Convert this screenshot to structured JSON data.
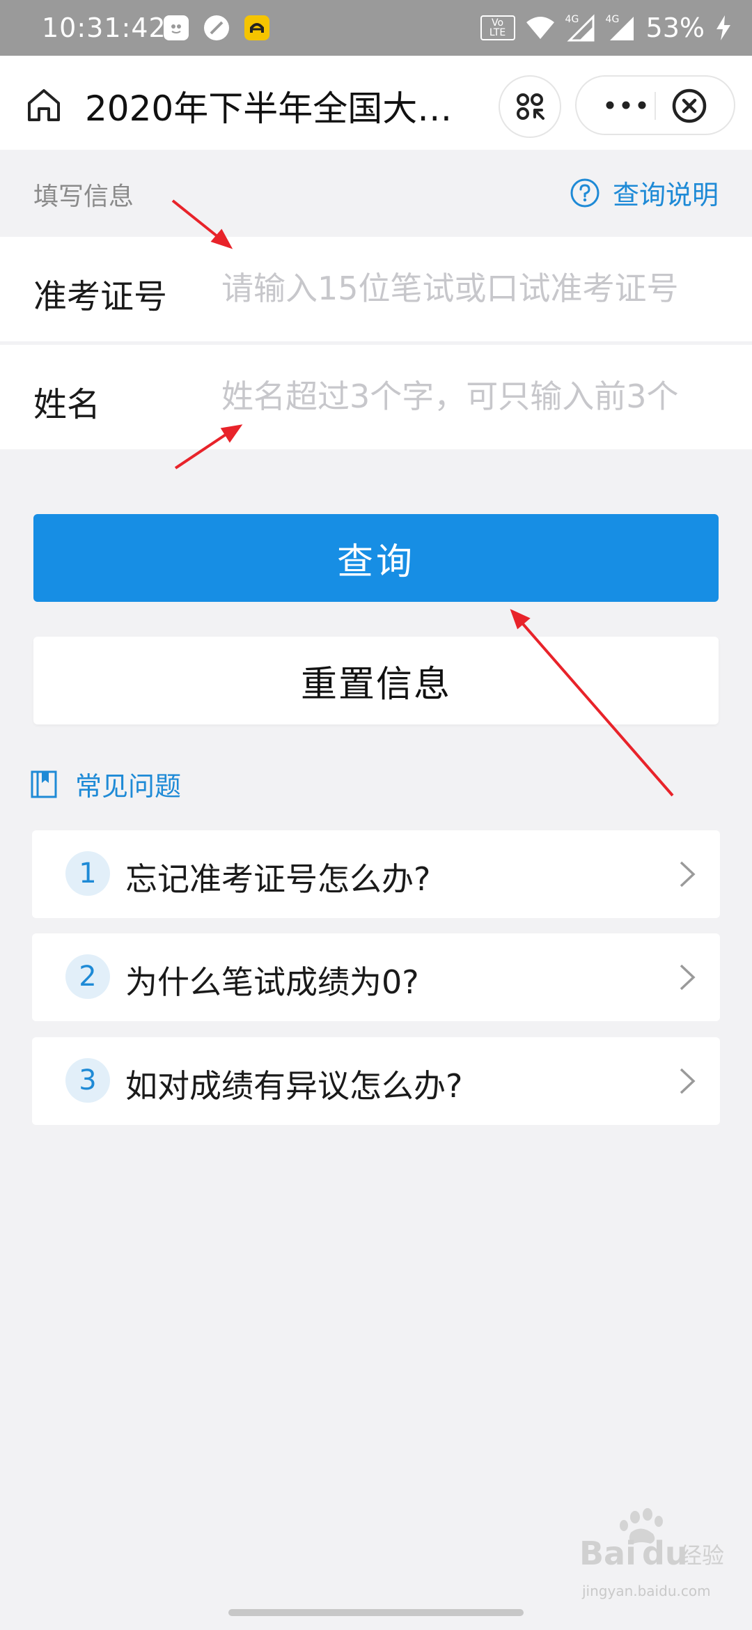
{
  "status_bar": {
    "time": "10:31:42",
    "battery": "53%",
    "lte_badge_top": "Vo LTE",
    "signal_labels": [
      "4G",
      "4G"
    ]
  },
  "nav": {
    "title": "2020年下半年全国大…"
  },
  "section": {
    "label": "填写信息",
    "help": "查询说明"
  },
  "form": {
    "ticket_label": "准考证号",
    "ticket_placeholder": "请输入15位笔试或口试准考证号",
    "name_label": "姓名",
    "name_placeholder": "姓名超过3个字，可只输入前3个"
  },
  "buttons": {
    "query": "查询",
    "reset": "重置信息"
  },
  "faq": {
    "title": "常见问题",
    "items": [
      {
        "num": "1",
        "text": "忘记准考证号怎么办?"
      },
      {
        "num": "2",
        "text": "为什么笔试成绩为0?"
      },
      {
        "num": "3",
        "text": "如对成绩有异议怎么办?"
      }
    ]
  },
  "watermark": {
    "brand": "Baidu经验",
    "url": "jingyan.baidu.com"
  },
  "colors": {
    "accent": "#178ee4",
    "link": "#1e8ad6",
    "annotation": "#e8232a"
  }
}
